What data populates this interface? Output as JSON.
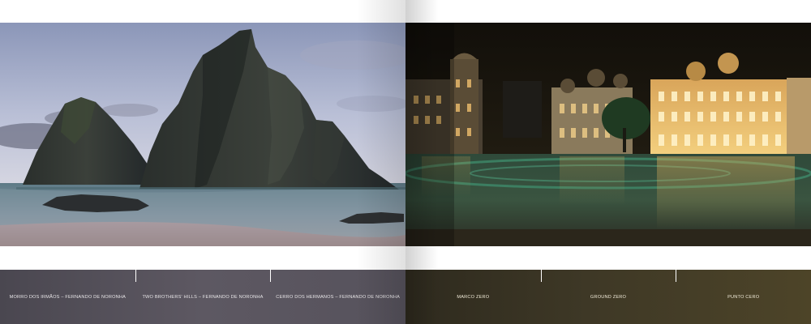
{
  "spread": {
    "left_page": {
      "photo": "Two rock peaks rising from a calm sea at dusk",
      "captions": [
        "Morro dos Irmãos – Fernando de Noronha",
        "Two Brothers' Hills – Fernando de Noronha",
        "Cerro dos Hermanos – Fernando de Noronha"
      ]
    },
    "right_page": {
      "photo": "Illuminated historic buildings around a wet plaza at night",
      "captions": [
        "Marco Zero",
        "Ground Zero",
        "Punto Cero"
      ]
    }
  }
}
